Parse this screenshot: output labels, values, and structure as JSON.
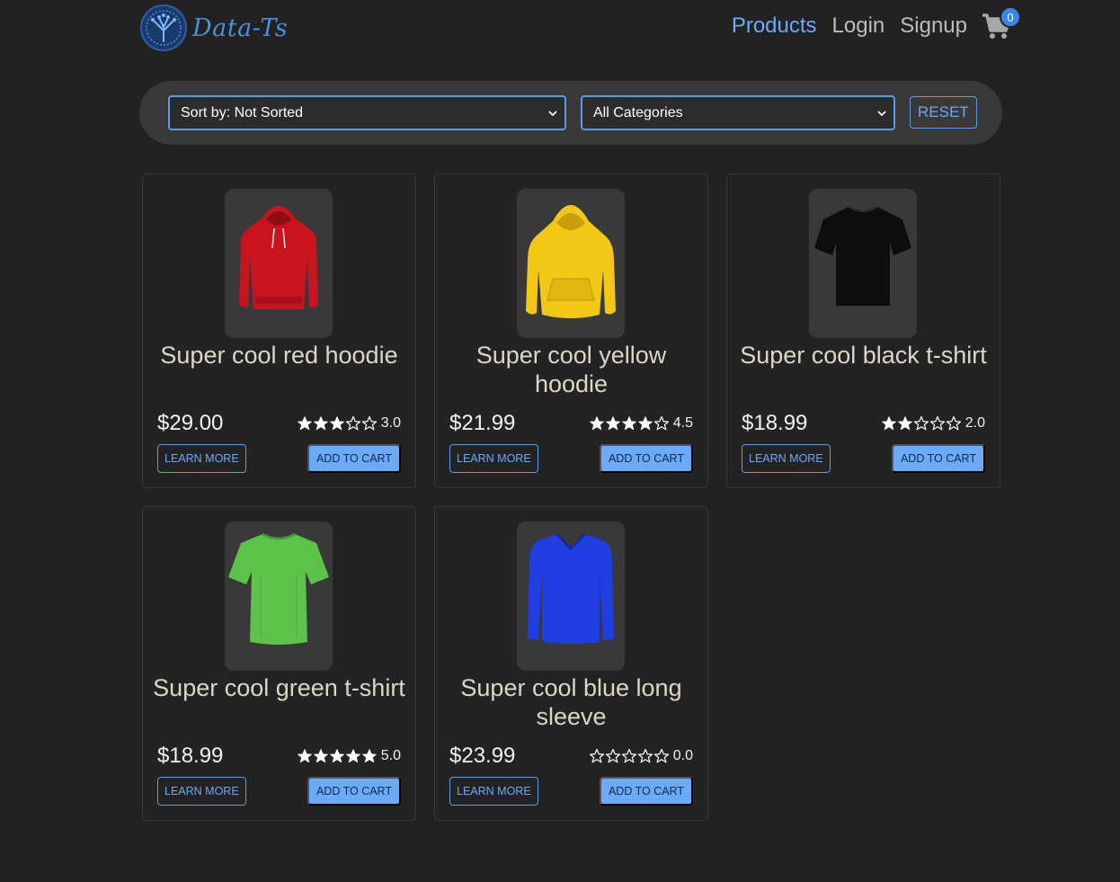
{
  "header": {
    "logo_text": "Data-Ts",
    "nav": {
      "products": "Products",
      "login": "Login",
      "signup": "Signup"
    },
    "cart_count": "0"
  },
  "filters": {
    "sort_value": "Sort by: Not Sorted",
    "category_value": "All Categories",
    "reset_label": "RESET"
  },
  "colors": {
    "accent": "#6aaaf7",
    "background": "#222222",
    "panel": "#393939"
  },
  "buttons": {
    "learn_more": "LEARN MORE",
    "add_to_cart": "ADD TO CART"
  },
  "products": [
    {
      "title": "Super cool red hoodie",
      "price": "$29.00",
      "rating": "3.0",
      "stars": 3,
      "image_icon": "red-hoodie-icon"
    },
    {
      "title": "Super cool yellow hoodie",
      "price": "$21.99",
      "rating": "4.5",
      "stars": 4,
      "image_icon": "yellow-hoodie-icon"
    },
    {
      "title": "Super cool black t-shirt",
      "price": "$18.99",
      "rating": "2.0",
      "stars": 2,
      "image_icon": "black-tshirt-icon"
    },
    {
      "title": "Super cool green t-shirt",
      "price": "$18.99",
      "rating": "5.0",
      "stars": 5,
      "image_icon": "green-tshirt-icon"
    },
    {
      "title": "Super cool blue long sleeve",
      "price": "$23.99",
      "rating": "0.0",
      "stars": 0,
      "image_icon": "blue-longsleeve-icon"
    }
  ]
}
